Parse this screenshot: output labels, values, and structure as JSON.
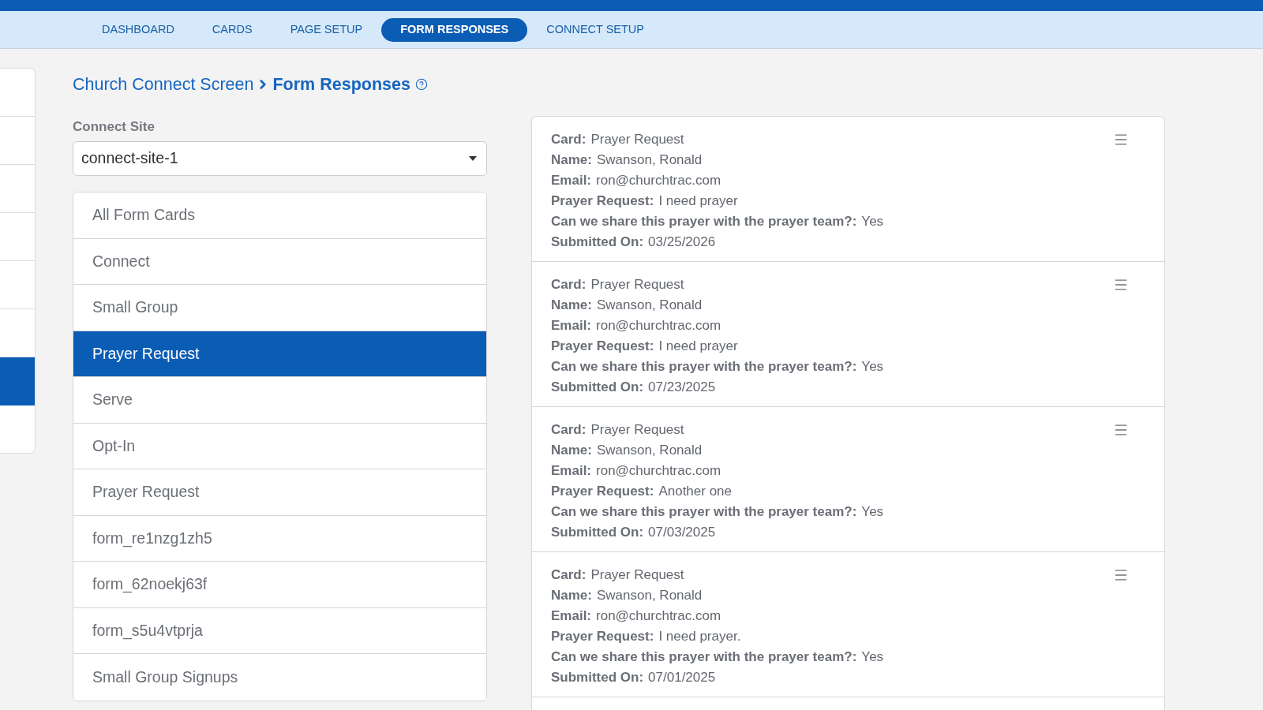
{
  "top_nav": {
    "tabs": [
      {
        "label": "DASHBOARD",
        "selected": false
      },
      {
        "label": "CARDS",
        "selected": false
      },
      {
        "label": "PAGE SETUP",
        "selected": false
      },
      {
        "label": "FORM RESPONSES",
        "selected": true
      },
      {
        "label": "CONNECT SETUP",
        "selected": false
      }
    ]
  },
  "sidebar": {
    "items": [
      {
        "selected": false
      },
      {
        "selected": false
      },
      {
        "selected": false
      },
      {
        "selected": false
      },
      {
        "selected": false
      },
      {
        "selected": false
      },
      {
        "selected": true
      },
      {
        "selected": false
      }
    ]
  },
  "breadcrumb": {
    "parent": "Church Connect Screen",
    "current": "Form Responses"
  },
  "connect_site": {
    "label": "Connect Site",
    "value": "connect-site-1"
  },
  "form_cards": [
    {
      "label": "All Form Cards",
      "selected": false
    },
    {
      "label": "Connect",
      "selected": false
    },
    {
      "label": "Small Group",
      "selected": false
    },
    {
      "label": "Prayer Request",
      "selected": true
    },
    {
      "label": "Serve",
      "selected": false
    },
    {
      "label": "Opt-In",
      "selected": false
    },
    {
      "label": "Prayer Request",
      "selected": false
    },
    {
      "label": "form_re1nzg1zh5",
      "selected": false
    },
    {
      "label": "form_62noekj63f",
      "selected": false
    },
    {
      "label": "form_s5u4vtprja",
      "selected": false
    },
    {
      "label": "Small Group Signups",
      "selected": false
    }
  ],
  "responses": [
    {
      "fields": [
        {
          "label": "Card:",
          "value": "Prayer Request"
        },
        {
          "label": "Name:",
          "value": "Swanson, Ronald"
        },
        {
          "label": "Email:",
          "value": "ron@churchtrac.com"
        },
        {
          "label": "Prayer Request:",
          "value": "I need prayer"
        },
        {
          "label": "Can we share this prayer with the prayer team?:",
          "value": "Yes"
        },
        {
          "label": "Submitted On:",
          "value": "03/25/2026"
        }
      ]
    },
    {
      "fields": [
        {
          "label": "Card:",
          "value": "Prayer Request"
        },
        {
          "label": "Name:",
          "value": "Swanson, Ronald"
        },
        {
          "label": "Email:",
          "value": "ron@churchtrac.com"
        },
        {
          "label": "Prayer Request:",
          "value": "I need prayer"
        },
        {
          "label": "Can we share this prayer with the prayer team?:",
          "value": "Yes"
        },
        {
          "label": "Submitted On:",
          "value": "07/23/2025"
        }
      ]
    },
    {
      "fields": [
        {
          "label": "Card:",
          "value": "Prayer Request"
        },
        {
          "label": "Name:",
          "value": "Swanson, Ronald"
        },
        {
          "label": "Email:",
          "value": "ron@churchtrac.com"
        },
        {
          "label": "Prayer Request:",
          "value": "Another one"
        },
        {
          "label": "Can we share this prayer with the prayer team?:",
          "value": "Yes"
        },
        {
          "label": "Submitted On:",
          "value": "07/03/2025"
        }
      ]
    },
    {
      "fields": [
        {
          "label": "Card:",
          "value": "Prayer Request"
        },
        {
          "label": "Name:",
          "value": "Swanson, Ronald"
        },
        {
          "label": "Email:",
          "value": "ron@churchtrac.com"
        },
        {
          "label": "Prayer Request:",
          "value": "I need prayer."
        },
        {
          "label": "Can we share this prayer with the prayer team?:",
          "value": "Yes"
        },
        {
          "label": "Submitted On:",
          "value": "07/01/2025"
        }
      ]
    }
  ]
}
